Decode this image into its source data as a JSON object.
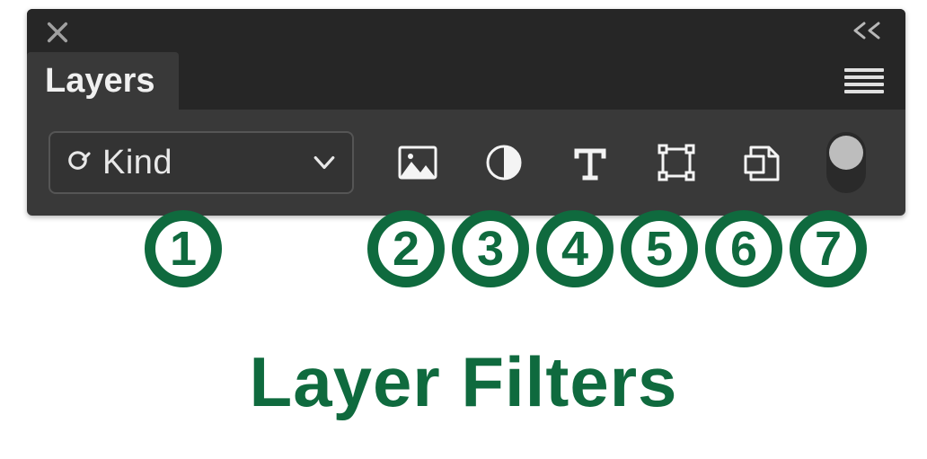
{
  "panel": {
    "title": "Layers",
    "filter": {
      "selected": "Kind"
    }
  },
  "annotations": {
    "badges": [
      "1",
      "2",
      "3",
      "4",
      "5",
      "6",
      "7"
    ],
    "caption": "Layer Filters"
  },
  "icon_names": {
    "close": "close-icon",
    "collapse": "collapse-left-icon",
    "menu": "panel-menu-icon",
    "search": "search-icon",
    "chevron": "chevron-down-icon",
    "pixel": "pixel-layers-icon",
    "adjust": "adjustment-layers-icon",
    "type": "type-layers-icon",
    "shape": "shape-layers-icon",
    "smart": "smart-objects-icon",
    "toggle": "filter-toggle"
  },
  "colors": {
    "badge": "#0f6a3e",
    "panel": "#393939",
    "panel_dark": "#262626"
  }
}
